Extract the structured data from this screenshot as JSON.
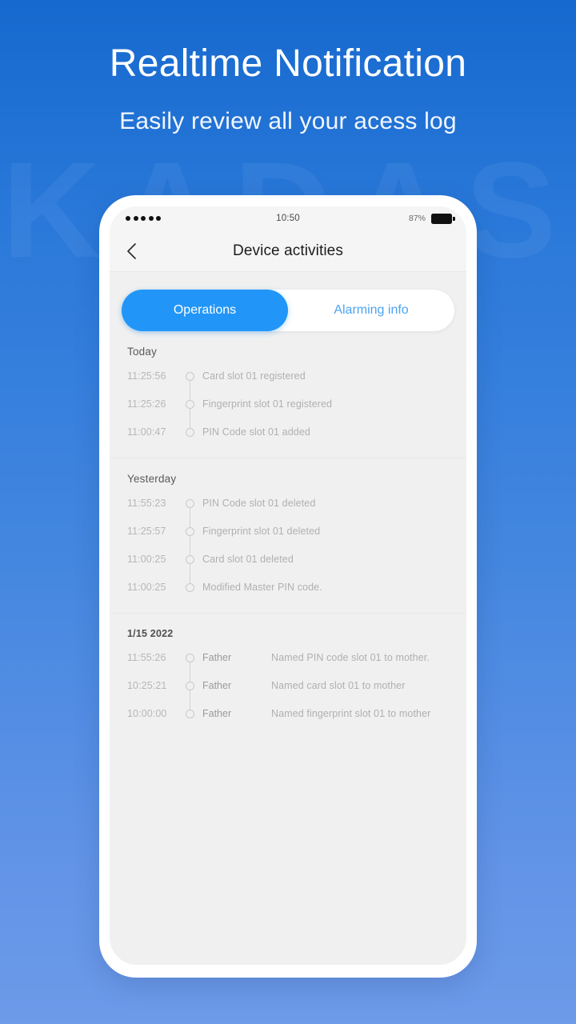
{
  "background": {
    "gradient_top": "#1669ce",
    "gradient_bottom": "#6d9ae9",
    "watermark_text": "KADAS"
  },
  "hero": {
    "title": "Realtime Notification",
    "subtitle": "Easily review all your acess log"
  },
  "phone": {
    "status_bar": {
      "signal_dots": 5,
      "time": "10:50",
      "battery_percent": "87%",
      "battery_icon": "battery-full-icon"
    },
    "nav": {
      "back_icon": "chevron-left-icon",
      "title": "Device activities"
    },
    "tabs": {
      "active_color": "#2196f8",
      "inactive_color": "#4da3f5",
      "items": [
        {
          "label": "Operations",
          "active": true
        },
        {
          "label": "Alarming info",
          "active": false
        }
      ]
    },
    "activity_sections": [
      {
        "heading": "Today",
        "dated": false,
        "rows": [
          {
            "time": "11:25:56",
            "user": "",
            "desc": "Card slot 01 registered"
          },
          {
            "time": "11:25:26",
            "user": "",
            "desc": "Fingerprint slot 01 registered"
          },
          {
            "time": "11:00:47",
            "user": "",
            "desc": "PIN Code slot 01 added"
          }
        ]
      },
      {
        "heading": "Yesterday",
        "dated": false,
        "rows": [
          {
            "time": "11:55:23",
            "user": "",
            "desc": "PIN Code slot 01 deleted"
          },
          {
            "time": "11:25:57",
            "user": "",
            "desc": "Fingerprint slot 01 deleted"
          },
          {
            "time": "11:00:25",
            "user": "",
            "desc": "Card slot 01 deleted"
          },
          {
            "time": "11:00:25",
            "user": "",
            "desc": "Modified Master PIN code."
          }
        ]
      },
      {
        "heading": "1/15  2022",
        "dated": true,
        "rows": [
          {
            "time": "11:55:26",
            "user": "Father",
            "desc": "Named PIN code slot 01 to mother."
          },
          {
            "time": "10:25:21",
            "user": "Father",
            "desc": "Named card slot 01 to mother"
          },
          {
            "time": "10:00:00",
            "user": "Father",
            "desc": "Named fingerprint slot 01 to mother"
          }
        ]
      }
    ]
  }
}
